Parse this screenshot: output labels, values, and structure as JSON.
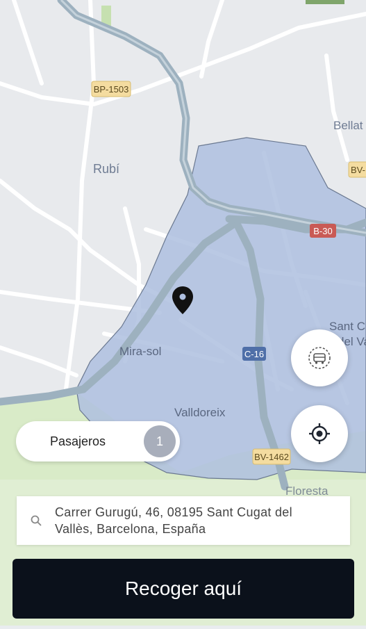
{
  "map": {
    "towns": [
      "Rubí",
      "Mira-sol",
      "Valldoreix",
      "Bellat",
      "Sant C",
      "del Va",
      "Floresta"
    ],
    "roads": [
      "BP-1503",
      "B-30",
      "C-16",
      "BV-1462",
      "BV-"
    ],
    "coverage_color": "#aebfdf",
    "pin_color": "#111111"
  },
  "passengers": {
    "label": "Pasajeros",
    "count": "1"
  },
  "address": {
    "line1": "Carrer Gurugú, 46, 08195 Sant Cugat del",
    "line2": "Vallès, Barcelona, España"
  },
  "cta": {
    "label": "Recoger aquí"
  },
  "icons": {
    "vehicle": "vehicle-select-icon",
    "locate": "my-location-icon",
    "search": "search-icon",
    "pin": "map-pin-icon"
  }
}
